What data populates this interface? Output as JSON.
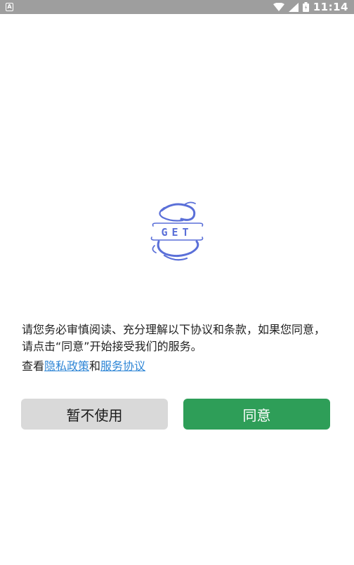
{
  "status_bar": {
    "app_icon_letter": "A",
    "time": "11:14",
    "icons": [
      "wifi-icon",
      "signal-icon",
      "battery-icon"
    ],
    "background": "#9e9e9e"
  },
  "logo": {
    "text": "GET",
    "color": "#5a6fd8"
  },
  "dialog": {
    "policy_text": "请您务必审慎阅读、充分理解以下协议和条款，如果您同意，请点击“同意”开始接受我们的服务。",
    "links_prefix": "查看",
    "privacy_link": "隐私政策",
    "links_conjunction": "和",
    "service_link": "服务协议",
    "link_color": "#2f86d6"
  },
  "buttons": {
    "decline_label": "暂不使用",
    "agree_label": "同意",
    "decline_color": "#d9d9d9",
    "agree_color": "#2e9e58"
  }
}
